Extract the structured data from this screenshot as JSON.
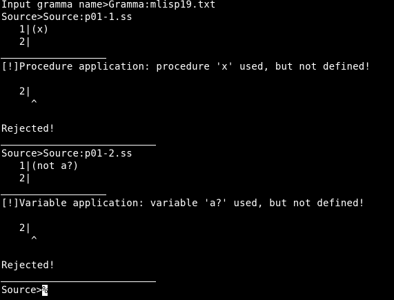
{
  "lines": {
    "gramma_prompt": "Input gramma name>Gramma:mlisp19.txt",
    "source1": "Source>Source:p01-1.ss",
    "s1_code1": "   1|(x)",
    "s1_code2": "   2|",
    "s1_error": "[!]Procedure application: procedure 'x' used, but not defined!",
    "s1_err_line": "   2|",
    "s1_caret": "     ^",
    "s1_rejected": "Rejected!",
    "source2": "Source>Source:p01-2.ss",
    "s2_code1": "   1|(not a?)",
    "s2_code2": "   2|",
    "s2_error": "[!]Variable application: variable 'a?' used, but not defined!",
    "s2_err_line": "   2|",
    "s2_caret": "     ^",
    "s2_rejected": "Rejected!",
    "final_prompt": "Source>",
    "cursor_char": "%"
  },
  "colors": {
    "background": "#000000",
    "foreground": "#ffffff"
  }
}
